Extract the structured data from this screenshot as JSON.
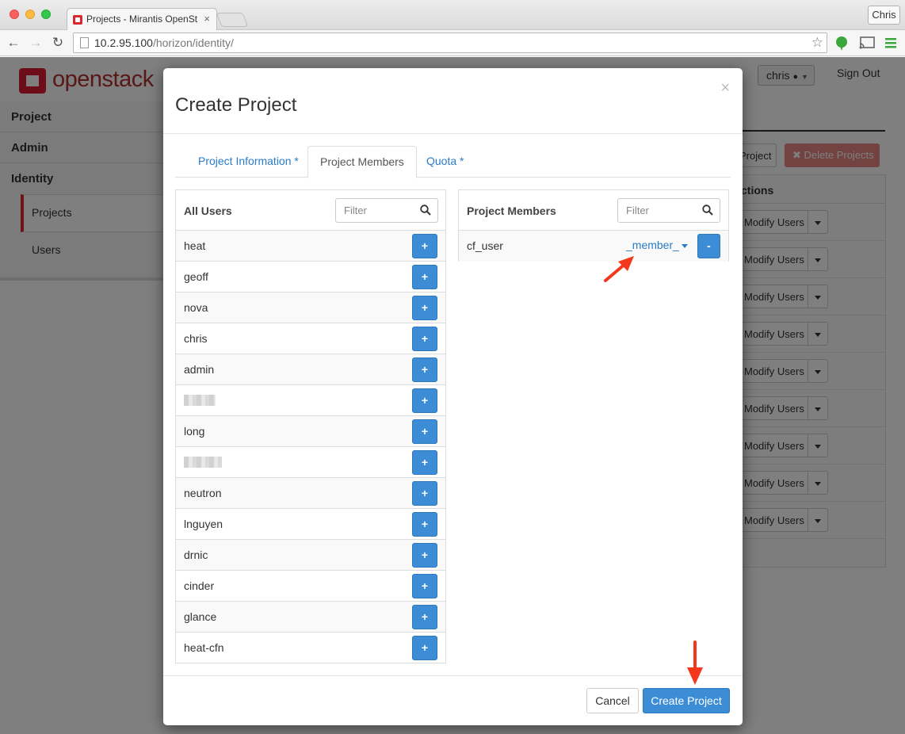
{
  "browser": {
    "tab_title": "Projects - Mirantis OpenSt",
    "tab_close": "×",
    "url_host": "10.2.95.100",
    "url_path": "/horizon/identity/",
    "profile_name": "Chris"
  },
  "header": {
    "logo_text": "openstack",
    "user_menu": "chris",
    "sign_out": "Sign Out"
  },
  "sidebar": {
    "sections": [
      "Project",
      "Admin",
      "Identity"
    ],
    "items": [
      "Projects",
      "Users"
    ]
  },
  "background": {
    "create_project_fragment": "Project",
    "delete_projects": "✖ Delete Projects",
    "actions_header": "ctions",
    "row_action": "Modify Users"
  },
  "modal": {
    "title": "Create Project",
    "close": "×",
    "tabs": [
      "Project Information *",
      "Project Members",
      "Quota *"
    ],
    "all_users": {
      "title": "All Users",
      "filter_placeholder": "Filter",
      "users": [
        "heat",
        "geoff",
        "nova",
        "chris",
        "admin",
        "",
        "long",
        "",
        "neutron",
        "lnguyen",
        "drnic",
        "cinder",
        "glance",
        "heat-cfn"
      ],
      "add_label": "+"
    },
    "members": {
      "title": "Project Members",
      "filter_placeholder": "Filter",
      "rows": [
        {
          "name": "cf_user",
          "role": "_member_",
          "remove_label": "-"
        }
      ]
    },
    "cancel": "Cancel",
    "submit": "Create Project"
  },
  "colors": {
    "primary": "#3c8dd5",
    "link": "#2a7cc7",
    "danger": "#d9534f",
    "annotation_arrow": "#f5371e"
  }
}
